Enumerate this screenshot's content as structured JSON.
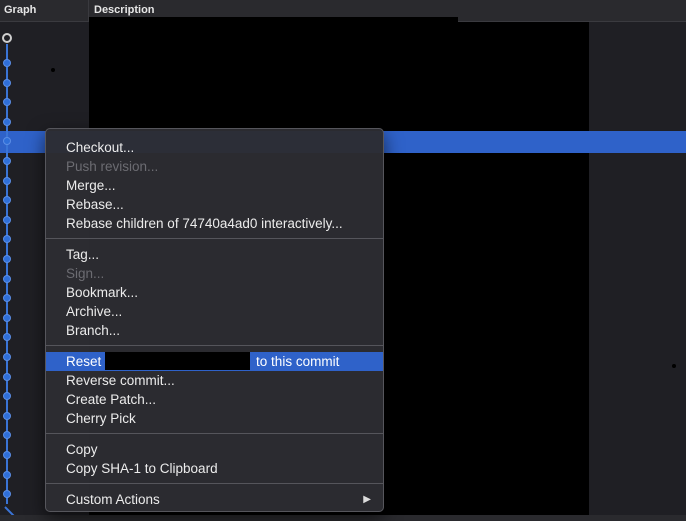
{
  "columns": {
    "graph": "Graph",
    "description": "Description"
  },
  "menu": {
    "group1": [
      {
        "label": "Checkout...",
        "enabled": true
      },
      {
        "label": "Push revision...",
        "enabled": false
      },
      {
        "label": "Merge...",
        "enabled": true
      },
      {
        "label": "Rebase...",
        "enabled": true
      },
      {
        "label": "Rebase children of 74740a4ad0 interactively...",
        "enabled": true
      }
    ],
    "group2": [
      {
        "label": "Tag...",
        "enabled": true
      },
      {
        "label": "Sign...",
        "enabled": false
      },
      {
        "label": "Bookmark...",
        "enabled": true
      },
      {
        "label": "Archive...",
        "enabled": true
      },
      {
        "label": "Branch...",
        "enabled": true
      }
    ],
    "group3": [
      {
        "prefix": "Reset",
        "suffix": "to this commit",
        "highlighted": true
      },
      {
        "label": "Reverse commit..."
      },
      {
        "label": "Create Patch..."
      },
      {
        "label": "Cherry Pick"
      }
    ],
    "group4": [
      {
        "label": "Copy"
      },
      {
        "label": "Copy SHA-1 to Clipboard"
      }
    ],
    "group5": [
      {
        "label": "Custom Actions",
        "submenu_icon": "chevron-right-icon"
      }
    ]
  },
  "colors": {
    "selection": "#2f62c9",
    "graph_line": "#3a74d6",
    "background": "#1f1f24"
  }
}
